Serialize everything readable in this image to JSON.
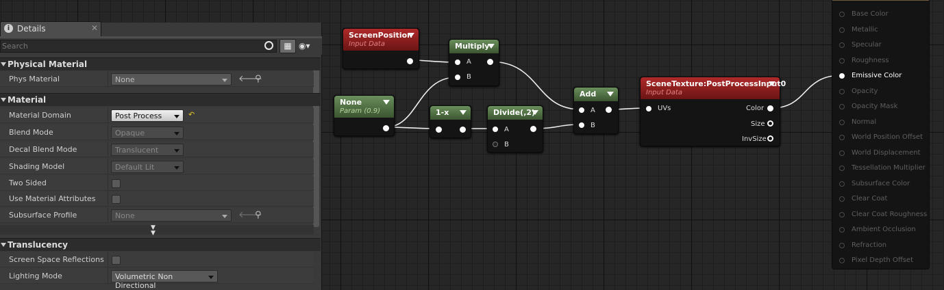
{
  "details": {
    "tab_title": "Details",
    "search_placeholder": "Search",
    "sections": {
      "physical": "Physical Material",
      "material": "Material",
      "translucency": "Translucency"
    },
    "rows": {
      "phys_material": {
        "label": "Phys Material",
        "value": "None"
      },
      "material_domain": {
        "label": "Material Domain",
        "value": "Post Process"
      },
      "blend_mode": {
        "label": "Blend Mode",
        "value": "Opaque"
      },
      "decal_blend_mode": {
        "label": "Decal Blend Mode",
        "value": "Translucent"
      },
      "shading_model": {
        "label": "Shading Model",
        "value": "Default Lit"
      },
      "two_sided": {
        "label": "Two Sided"
      },
      "use_material_attributes": {
        "label": "Use Material Attributes"
      },
      "subsurface_profile": {
        "label": "Subsurface Profile",
        "value": "None"
      },
      "ssr": {
        "label": "Screen Space Reflections"
      },
      "lighting_mode": {
        "label": "Lighting Mode",
        "value": "Volumetric Non Directional"
      }
    }
  },
  "nodes": {
    "screen_position": {
      "title": "ScreenPosition",
      "subtitle": "Input Data"
    },
    "multiply": {
      "title": "Multiply",
      "pin_a": "A",
      "pin_b": "B"
    },
    "none_param": {
      "title": "None",
      "subtitle": "Param (0.9)"
    },
    "one_minus": {
      "title": "1-x"
    },
    "divide": {
      "title": "Divide(,2)",
      "pin_a": "A",
      "pin_b": "B"
    },
    "add": {
      "title": "Add",
      "pin_a": "A",
      "pin_b": "B"
    },
    "scene_texture": {
      "title": "SceneTexture:PostProcessInput0",
      "subtitle": "Input Data",
      "in_uvs": "UVs",
      "out_color": "Color",
      "out_size": "Size",
      "out_invsize": "InvSize"
    }
  },
  "output_node": {
    "pins": [
      "Base Color",
      "Metallic",
      "Specular",
      "Roughness",
      "Emissive Color",
      "Opacity",
      "Opacity Mask",
      "Normal",
      "World Position Offset",
      "World Displacement",
      "Tessellation Multiplier",
      "Subsurface Color",
      "Clear Coat",
      "Clear Coat Roughness",
      "Ambient Occlusion",
      "Refraction",
      "Pixel Depth Offset"
    ],
    "active_pin": "Emissive Color"
  }
}
